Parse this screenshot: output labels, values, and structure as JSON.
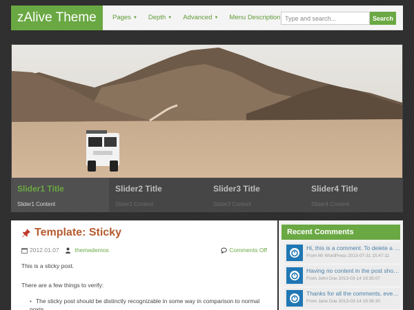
{
  "header": {
    "logo": "zAlive Theme",
    "nav": [
      {
        "label": "Pages",
        "dropdown": true
      },
      {
        "label": "Depth",
        "dropdown": true
      },
      {
        "label": "Advanced",
        "dropdown": true
      },
      {
        "label": "Menu Description",
        "dropdown": false
      }
    ],
    "search": {
      "placeholder": "Type and search...",
      "button": "Search"
    }
  },
  "slider": {
    "image_icon": "desert-mountains-jeep-photo",
    "tabs": [
      {
        "title": "Slider1 Title",
        "content": "Slider1 Content",
        "active": true
      },
      {
        "title": "Slider2 Title",
        "content": "Slider2 Content",
        "active": false
      },
      {
        "title": "Slider3 Title",
        "content": "Slider3 Content",
        "active": false
      },
      {
        "title": "Slider4 Title",
        "content": "Slider4 Content",
        "active": false
      }
    ]
  },
  "post": {
    "icon": "pushpin-icon",
    "title": "Template: Sticky",
    "date": "2012.01.07",
    "author": "themedemos",
    "comments": "Comments Off",
    "paragraphs": [
      "This is a sticky post.",
      "There are a few things to verify:"
    ],
    "list": [
      "The sticky post should be distinctly recognizable in some way in comparison to normal posts."
    ]
  },
  "sidebar": {
    "title": "Recent Comments",
    "comments": [
      {
        "text": "Hi, this is a comment. To delete a comment, just log in",
        "meta": "From Mr WordPress  2013-07-31 15:47:11"
      },
      {
        "text": "Having no content in the post should",
        "meta": "From John Doe  2013-03-14 19:35:07"
      },
      {
        "text": "Thanks for all the comments, everyone!",
        "meta": "From Jane Doe  2013-03-14 19:36:30"
      }
    ]
  },
  "colors": {
    "accent": "#6aa843",
    "title": "#b55a2e",
    "background": "#2f2f2f"
  }
}
